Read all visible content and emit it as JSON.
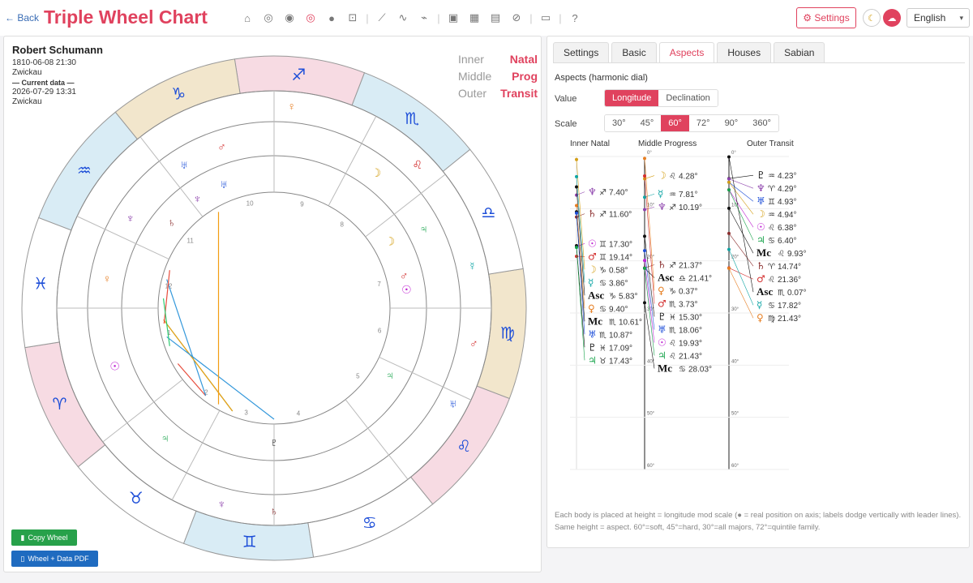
{
  "topbar": {
    "back_label": "← Back",
    "title": "Triple Wheel Chart",
    "icons": [
      "home-icon",
      "circle-icon",
      "double-circle-icon",
      "target-icon",
      "disc-icon",
      "robot-icon",
      "chart-line-icon",
      "wave-icon",
      "pulse-icon",
      "image-icon",
      "calendar-icon",
      "calendar-grid-icon",
      "compass-icon",
      "clipboard-icon",
      "help-icon"
    ],
    "settings_label": "⚙ Settings",
    "language": "English"
  },
  "person": {
    "name": "Robert Schumann",
    "birth": "1810-06-08 21:30",
    "place": "Zwickau",
    "current_label": "— Current data —",
    "current": "2026-07-29 13:31",
    "current_place": "Zwickau"
  },
  "legend": [
    {
      "ring": "Inner",
      "value": "Natal"
    },
    {
      "ring": "Middle",
      "value": "Prog"
    },
    {
      "ring": "Outer",
      "value": "Transit"
    }
  ],
  "buttons": {
    "copy": "Copy Wheel",
    "pdf": "Wheel + Data PDF"
  },
  "tabs": [
    "Settings",
    "Basic",
    "Aspects",
    "Houses",
    "Sabian"
  ],
  "active_tab": "Aspects",
  "aspects": {
    "section_title": "Aspects (harmonic dial)",
    "value_label": "Value",
    "value_options": [
      "Longitude",
      "Declination"
    ],
    "value_selected": "Longitude",
    "scale_label": "Scale",
    "scale_options": [
      "30°",
      "45°",
      "60°",
      "72°",
      "90°",
      "360°"
    ],
    "scale_selected": "60°",
    "columns": [
      "Inner Natal",
      "Middle Progress",
      "Outer Transit"
    ],
    "note": "Each body is placed at height = longitude mod scale (● = real position on axis; labels dodge vertically with leader lines). Same height = aspect. 60°=soft, 45°=hard, 30°=all majors, 72°=quintile family."
  },
  "dial": {
    "ticks": [
      "0°",
      "10°",
      "20°",
      "30°",
      "40°",
      "50°",
      "60°"
    ],
    "natal": [
      {
        "glyph": "♆",
        "sign": "♐",
        "deg": "7.40°",
        "color": "#8e44ad"
      },
      {
        "glyph": "♄",
        "sign": "♐",
        "deg": "11.60°",
        "color": "#8b2f2f"
      },
      {
        "glyph": "☉",
        "sign": "♊",
        "deg": "17.30°",
        "color": "#c026d3"
      },
      {
        "glyph": "♂",
        "sign": "♊",
        "deg": "19.14°",
        "color": "#d32f2f"
      },
      {
        "glyph": "☽",
        "sign": "♑",
        "deg": "0.58°",
        "color": "#d4a017"
      },
      {
        "glyph": "☿",
        "sign": "♋",
        "deg": "3.86°",
        "color": "#0ea5a5"
      },
      {
        "glyph": "Asc",
        "sign": "♑",
        "deg": "5.83°",
        "color": "#111"
      },
      {
        "glyph": "♀",
        "sign": "♋",
        "deg": "9.40°",
        "color": "#e67e22"
      },
      {
        "glyph": "Mc",
        "sign": "♏",
        "deg": "10.61°",
        "color": "#111"
      },
      {
        "glyph": "♅",
        "sign": "♏",
        "deg": "10.87°",
        "color": "#1d4ed8"
      },
      {
        "glyph": "♇",
        "sign": "♓",
        "deg": "17.09°",
        "color": "#111"
      },
      {
        "glyph": "♃",
        "sign": "♉",
        "deg": "17.43°",
        "color": "#16a34a"
      }
    ],
    "prog": [
      {
        "glyph": "☽",
        "sign": "♌",
        "deg": "4.28°",
        "color": "#d4a017"
      },
      {
        "glyph": "☿",
        "sign": "♒",
        "deg": "7.81°",
        "color": "#0ea5a5"
      },
      {
        "glyph": "♆",
        "sign": "♐",
        "deg": "10.19°",
        "color": "#8e44ad"
      },
      {
        "glyph": "♄",
        "sign": "♐",
        "deg": "21.37°",
        "color": "#8b2f2f"
      },
      {
        "glyph": "Asc",
        "sign": "♎",
        "deg": "21.41°",
        "color": "#111"
      },
      {
        "glyph": "♀",
        "sign": "♑",
        "deg": "0.37°",
        "color": "#e67e22"
      },
      {
        "glyph": "♂",
        "sign": "♏",
        "deg": "3.73°",
        "color": "#d32f2f"
      },
      {
        "glyph": "♇",
        "sign": "♓",
        "deg": "15.30°",
        "color": "#111"
      },
      {
        "glyph": "♅",
        "sign": "♏",
        "deg": "18.06°",
        "color": "#1d4ed8"
      },
      {
        "glyph": "☉",
        "sign": "♌",
        "deg": "19.93°",
        "color": "#c026d3"
      },
      {
        "glyph": "♃",
        "sign": "♌",
        "deg": "21.43°",
        "color": "#16a34a"
      },
      {
        "glyph": "Mc",
        "sign": "♋",
        "deg": "28.03°",
        "color": "#111"
      }
    ],
    "transit": [
      {
        "glyph": "♇",
        "sign": "♒",
        "deg": "4.23°",
        "color": "#111"
      },
      {
        "glyph": "♆",
        "sign": "♈",
        "deg": "4.29°",
        "color": "#8e44ad"
      },
      {
        "glyph": "♅",
        "sign": "♊",
        "deg": "4.93°",
        "color": "#1d4ed8"
      },
      {
        "glyph": "☽",
        "sign": "♒",
        "deg": "4.94°",
        "color": "#d4a017"
      },
      {
        "glyph": "☉",
        "sign": "♌",
        "deg": "6.38°",
        "color": "#c026d3"
      },
      {
        "glyph": "♃",
        "sign": "♋",
        "deg": "6.40°",
        "color": "#16a34a"
      },
      {
        "glyph": "Mc",
        "sign": "♌",
        "deg": "9.93°",
        "color": "#111"
      },
      {
        "glyph": "♄",
        "sign": "♈",
        "deg": "14.74°",
        "color": "#8b2f2f"
      },
      {
        "glyph": "♂",
        "sign": "♌",
        "deg": "21.36°",
        "color": "#d32f2f"
      },
      {
        "glyph": "Asc",
        "sign": "♏",
        "deg": "0.07°",
        "color": "#111"
      },
      {
        "glyph": "☿",
        "sign": "♋",
        "deg": "17.82°",
        "color": "#0ea5a5"
      },
      {
        "glyph": "♀",
        "sign": "♍",
        "deg": "21.43°",
        "color": "#e67e22"
      }
    ]
  },
  "wheel": {
    "signs": [
      "♈",
      "♉",
      "♊",
      "♋",
      "♌",
      "♍",
      "♎",
      "♏",
      "♐",
      "♑",
      "♒",
      "♓"
    ],
    "sign_colors": [
      "#f7dbe3",
      "#fff",
      "#d9ecf5",
      "#fff",
      "#f7dbe3",
      "#f2e6cc",
      "#fff",
      "#d9ecf5",
      "#f7dbe3",
      "#f2e6cc",
      "#d9ecf5",
      "#fff"
    ],
    "house_numbers": [
      "1",
      "2",
      "3",
      "4",
      "5",
      "6",
      "7",
      "8",
      "9",
      "10",
      "11",
      "12"
    ]
  }
}
